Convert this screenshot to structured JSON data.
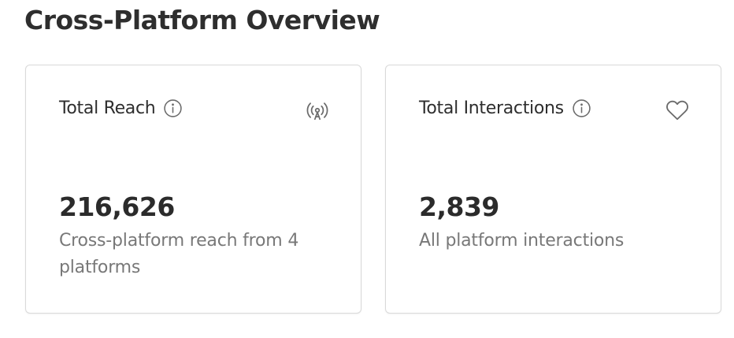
{
  "page": {
    "title": "Cross-Platform Overview"
  },
  "cards": [
    {
      "title": "Total Reach",
      "info_icon": "info-icon",
      "corner_icon": "broadcast-tower-icon",
      "value": "216,626",
      "description": "Cross-platform reach from 4 platforms"
    },
    {
      "title": "Total Interactions",
      "info_icon": "info-icon",
      "corner_icon": "heart-icon",
      "value": "2,839",
      "description": "All platform interactions"
    }
  ],
  "colors": {
    "title_text": "#2e2e2e",
    "value_text": "#2b2b2b",
    "description_text": "#787878",
    "icon": "#6b6b6b",
    "card_border": "#d9d9d9"
  }
}
